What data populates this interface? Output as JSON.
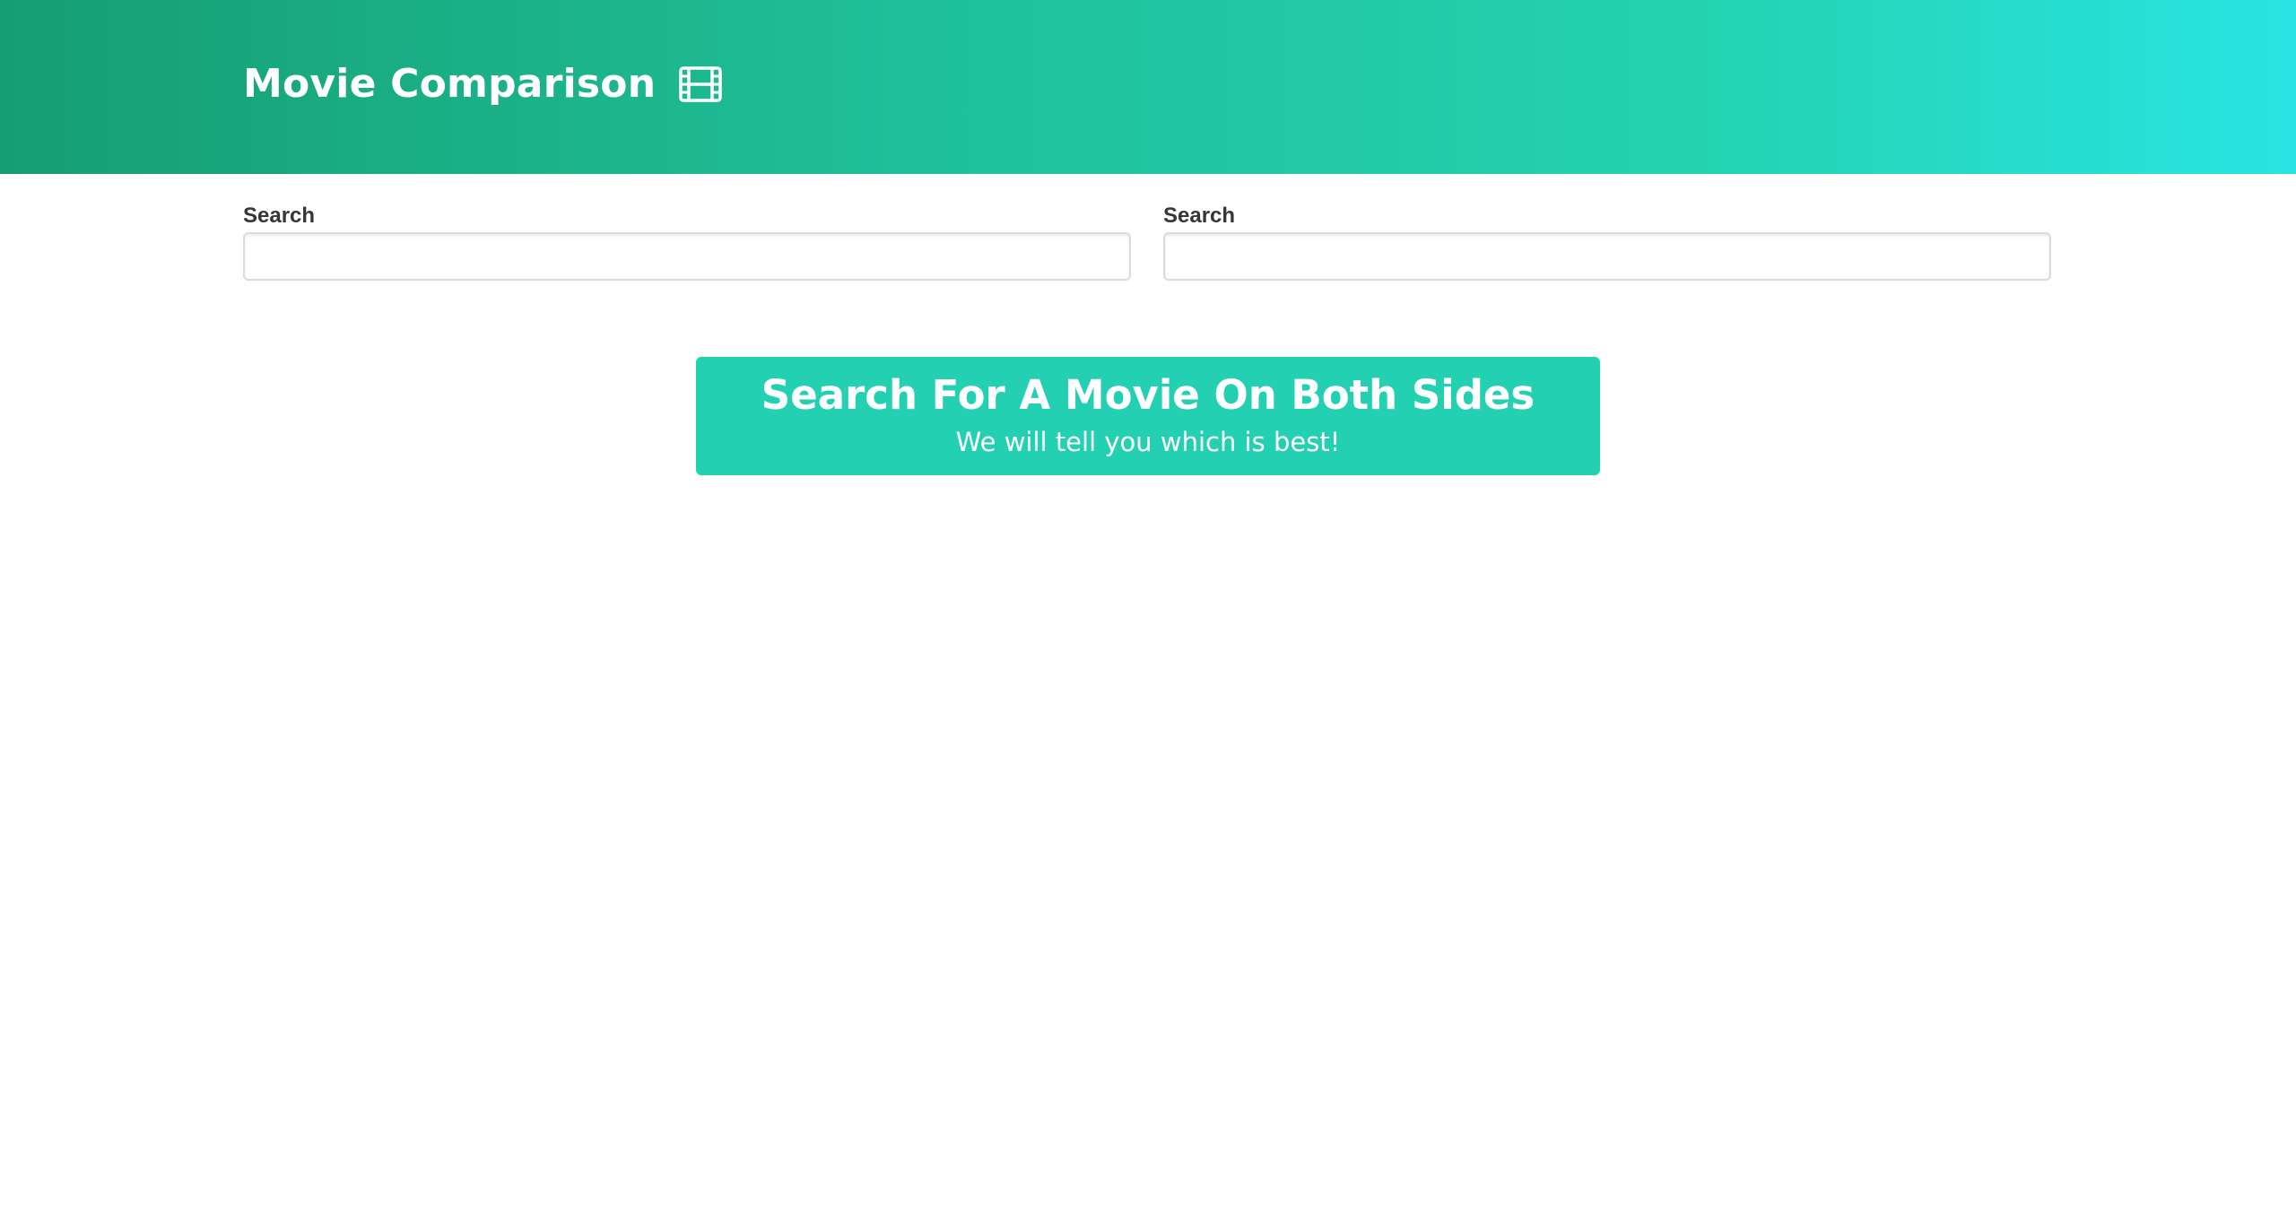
{
  "header": {
    "title": "Movie Comparison",
    "icon": "film-icon",
    "gradient_start": "#169e72",
    "gradient_end": "#29e4e3"
  },
  "search": {
    "left": {
      "label": "Search",
      "value": "",
      "placeholder": ""
    },
    "right": {
      "label": "Search",
      "value": "",
      "placeholder": ""
    }
  },
  "notification": {
    "title": "Search For A Movie On Both Sides",
    "subtitle": "We will tell you which is best!",
    "color": "#23d0b1"
  }
}
